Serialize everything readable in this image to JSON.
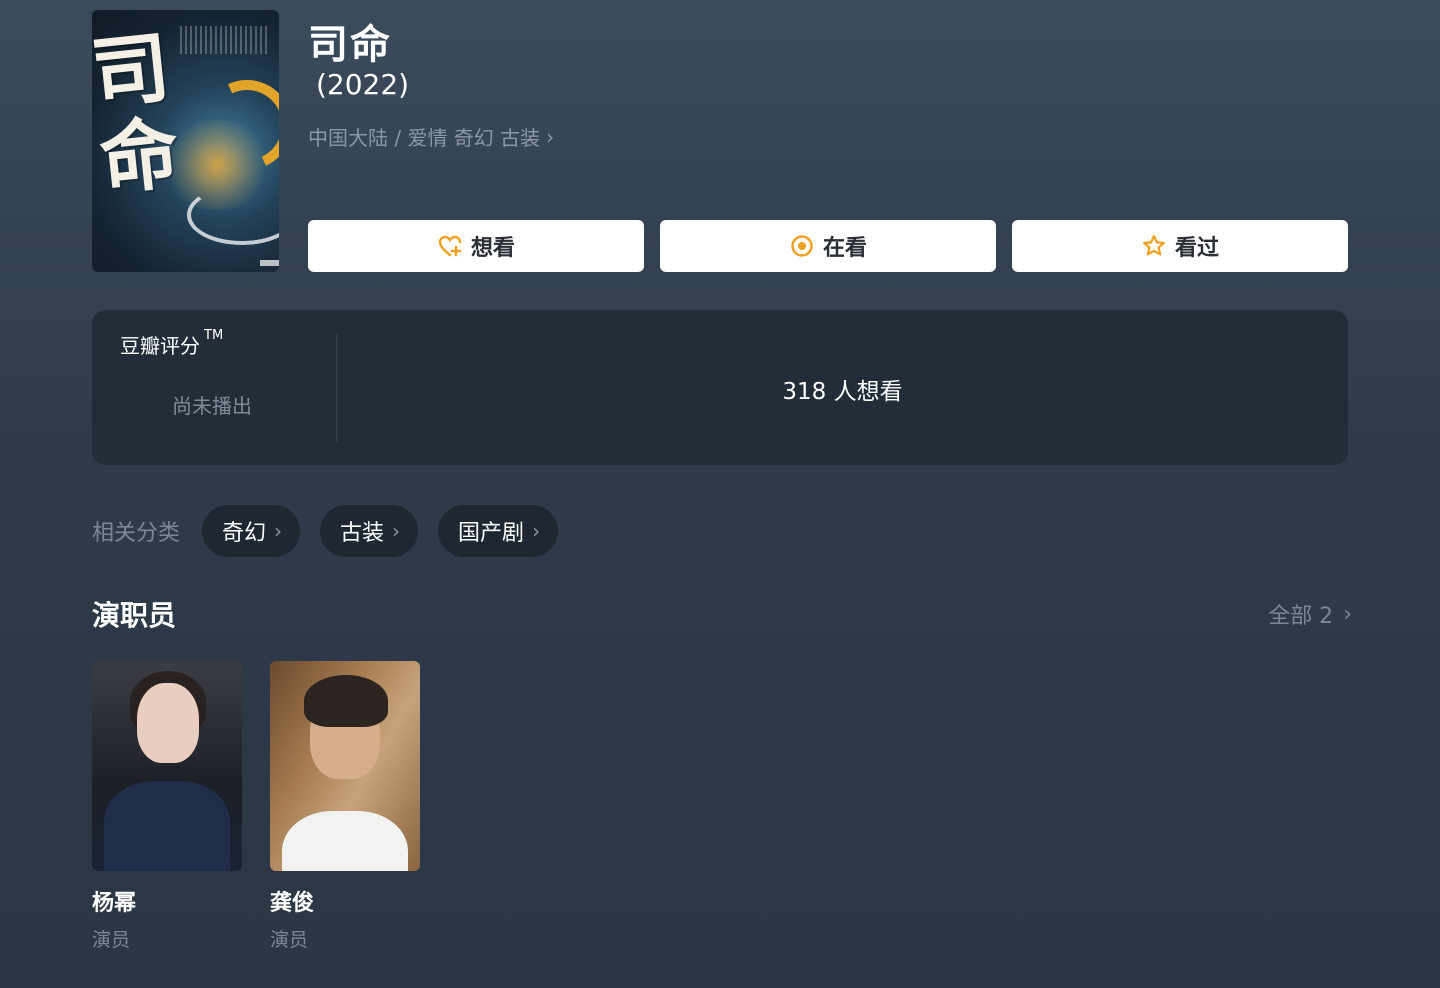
{
  "show": {
    "poster_text": "司命",
    "title": "司命",
    "year": "(2022)",
    "meta": "中国大陆 / 爱情 奇幻 古装",
    "meta_chevron": "›"
  },
  "actions": [
    {
      "label": "想看",
      "icon": "heart-plus-icon"
    },
    {
      "label": "在看",
      "icon": "target-circle-icon"
    },
    {
      "label": "看过",
      "icon": "star-outline-icon"
    }
  ],
  "rating": {
    "label": "豆瓣评分",
    "trademark": "TM",
    "status": "尚未播出",
    "wish_count_text": "318 人想看"
  },
  "related": {
    "label": "相关分类",
    "categories": [
      {
        "label": "奇幻"
      },
      {
        "label": "古装"
      },
      {
        "label": "国产剧"
      }
    ]
  },
  "cast": {
    "title": "演职员",
    "all_label": "全部 2",
    "members": [
      {
        "name": "杨幂",
        "role": "演员"
      },
      {
        "name": "龚俊",
        "role": "演员"
      }
    ]
  },
  "colors": {
    "accent": "#f0a020",
    "button_bg": "#ffffff",
    "panel_bg": "#222d39",
    "chip_bg": "#1f2832",
    "muted_text": "#7b8896"
  }
}
